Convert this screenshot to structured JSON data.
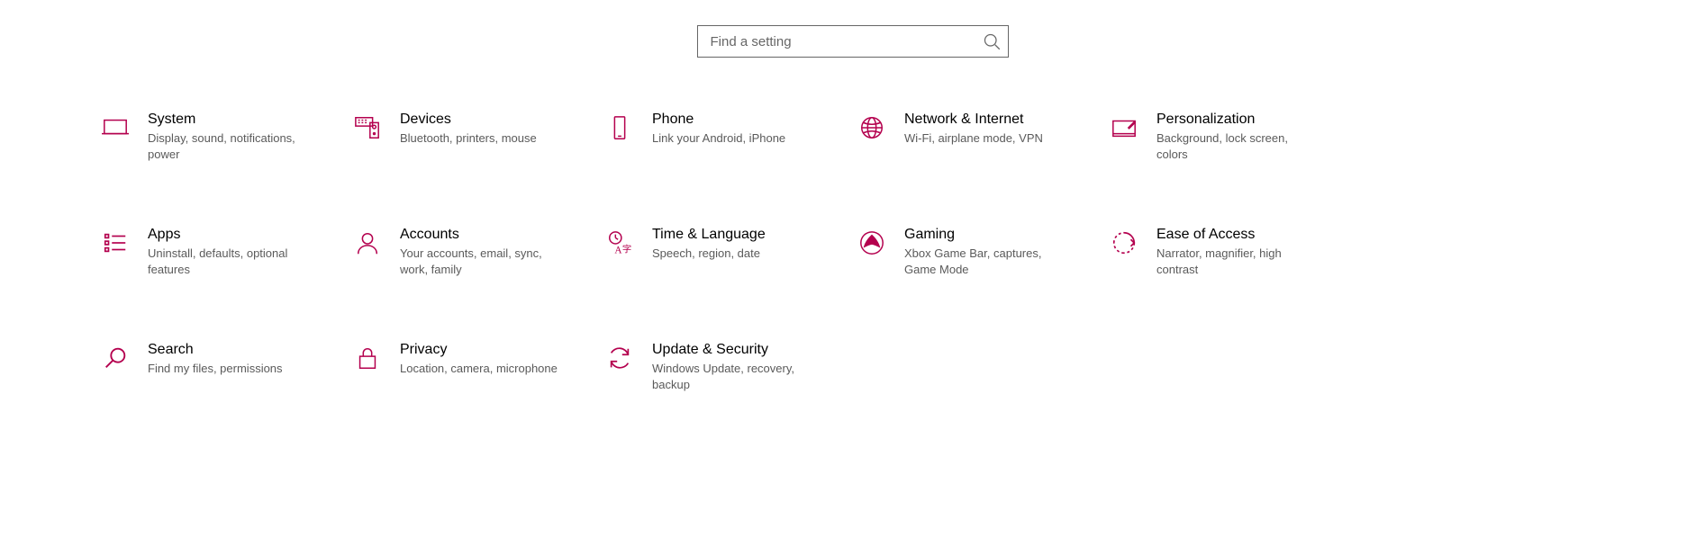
{
  "search": {
    "placeholder": "Find a setting"
  },
  "accent_color": "#b4004e",
  "categories": [
    {
      "id": "system",
      "title": "System",
      "desc": "Display, sound, notifications, power"
    },
    {
      "id": "devices",
      "title": "Devices",
      "desc": "Bluetooth, printers, mouse"
    },
    {
      "id": "phone",
      "title": "Phone",
      "desc": "Link your Android, iPhone"
    },
    {
      "id": "network",
      "title": "Network & Internet",
      "desc": "Wi-Fi, airplane mode, VPN"
    },
    {
      "id": "personalization",
      "title": "Personalization",
      "desc": "Background, lock screen, colors"
    },
    {
      "id": "apps",
      "title": "Apps",
      "desc": "Uninstall, defaults, optional features"
    },
    {
      "id": "accounts",
      "title": "Accounts",
      "desc": "Your accounts, email, sync, work, family"
    },
    {
      "id": "time",
      "title": "Time & Language",
      "desc": "Speech, region, date"
    },
    {
      "id": "gaming",
      "title": "Gaming",
      "desc": "Xbox Game Bar, captures, Game Mode"
    },
    {
      "id": "ease",
      "title": "Ease of Access",
      "desc": "Narrator, magnifier, high contrast"
    },
    {
      "id": "search",
      "title": "Search",
      "desc": "Find my files, permissions"
    },
    {
      "id": "privacy",
      "title": "Privacy",
      "desc": "Location, camera, microphone"
    },
    {
      "id": "update",
      "title": "Update & Security",
      "desc": "Windows Update, recovery, backup"
    }
  ]
}
